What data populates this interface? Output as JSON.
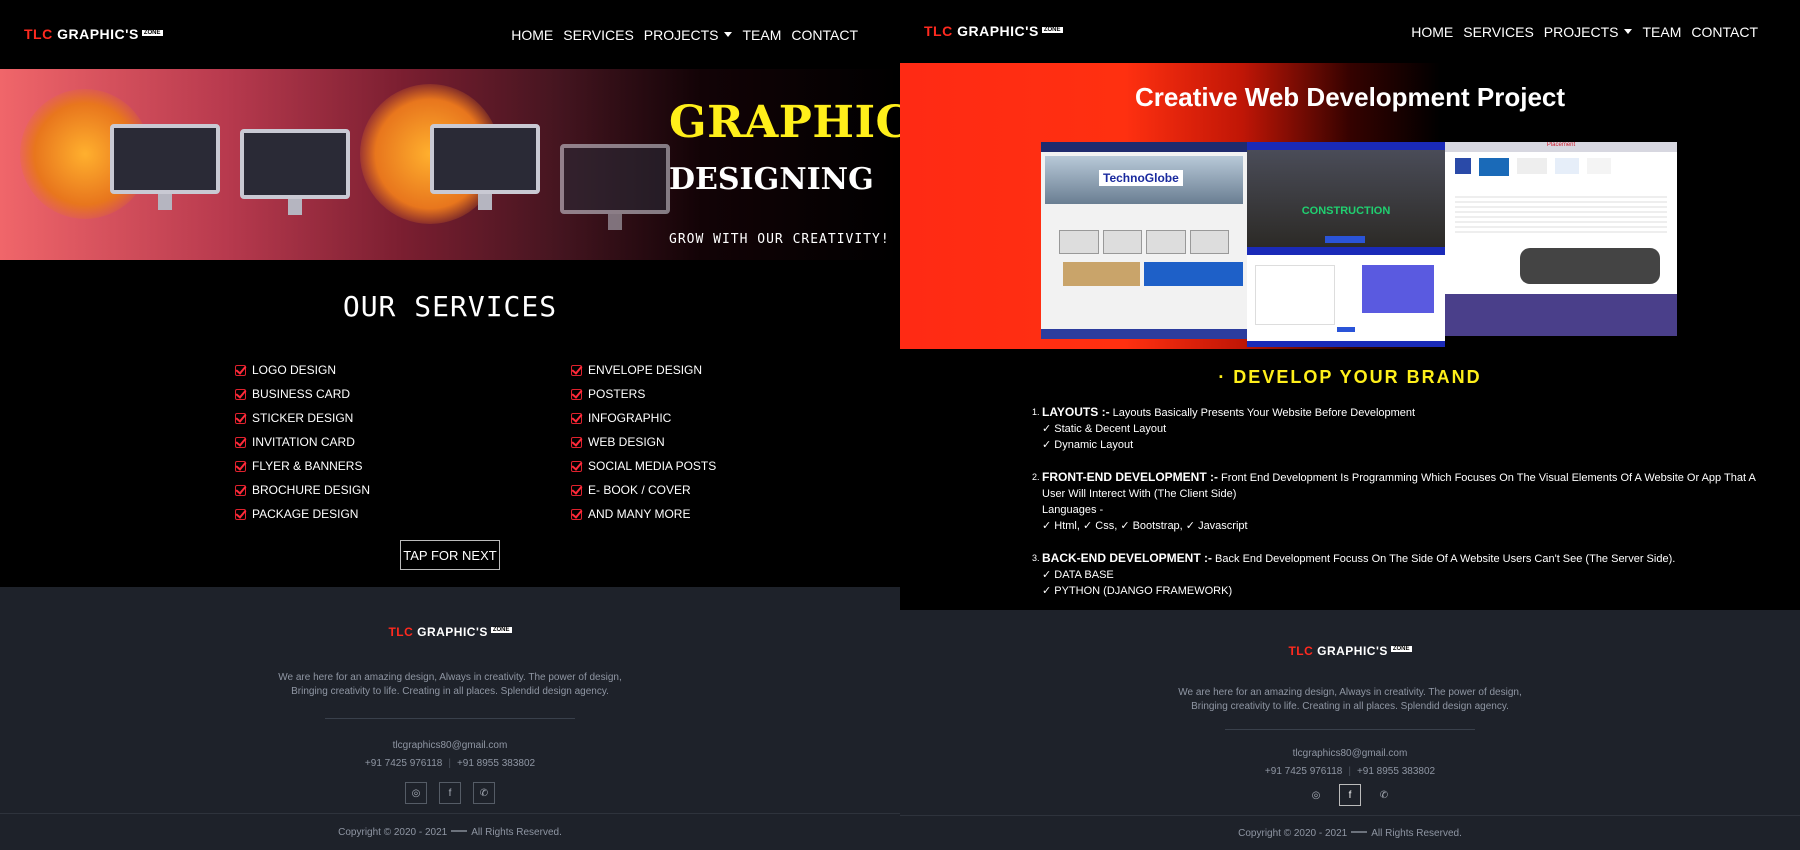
{
  "left": {
    "logo": {
      "tlc": "TLC",
      "graphics": "GRAPHIC'S",
      "zone": "ZONE"
    },
    "nav": {
      "home": "HOME",
      "services": "SERVICES",
      "projects": "PROJECTS",
      "team": "TEAM",
      "contact": "CONTACT"
    },
    "hero": {
      "title1": "GRAPHIC",
      "title2": "DESIGNING",
      "tagline": "GROW WITH OUR CREATIVITY!"
    },
    "services_title": "OUR SERVICES",
    "services_left": [
      "LOGO DESIGN",
      "BUSINESS CARD",
      "STICKER DESIGN",
      "INVITATION CARD",
      "FLYER & BANNERS",
      "BROCHURE DESIGN",
      "PACKAGE DESIGN"
    ],
    "services_right": [
      "ENVELOPE DESIGN",
      "POSTERS",
      "INFOGRAPHIC",
      "WEB DESIGN",
      "SOCIAL MEDIA POSTS",
      "E- BOOK / COVER",
      "AND MANY MORE"
    ],
    "next_button": "TAP FOR NEXT"
  },
  "right": {
    "logo": {
      "tlc": "TLC",
      "graphics": "GRAPHIC'S",
      "zone": "ZONE"
    },
    "nav": {
      "home": "HOME",
      "services": "SERVICES",
      "projects": "PROJECTS",
      "team": "TEAM",
      "contact": "CONTACT"
    },
    "title": "Creative Web Development Project",
    "brand": "· DEVELOP YOUR BRAND",
    "items": [
      {
        "num": "1.",
        "head": "LAYOUTS :-",
        "desc": " Layouts Basically Presents Your Website Before Development",
        "lines": [
          "✓ Static & Decent Layout",
          "✓ Dynamic Layout"
        ]
      },
      {
        "num": "2.",
        "head": "FRONT-END DEVELOPMENT :-",
        "desc": " Front End Development Is Programming Which Focuses On The Visual Elements Of A Website Or App That A User Will Interect With (The Client Side)",
        "lines": [
          "Languages -",
          "✓ Html, ✓ Css, ✓ Bootstrap, ✓ Javascript"
        ]
      },
      {
        "num": "3.",
        "head": "BACK-END DEVELOPMENT :-",
        "desc": " Back End Development Focuss On The Side Of A Website Users Can't See (The Server Side).",
        "lines": [
          "✓ DATA BASE",
          "✓ PYTHON (DJANGO FRAMEWORK)"
        ]
      }
    ],
    "screens": {
      "a": "TechnoGlobe",
      "b": "CONSTRUCTION",
      "c": "Placement"
    }
  },
  "footer": {
    "text1": "We are here for an amazing design, Always in creativity. The power of design,",
    "text2": "Bringing creativity to life. Creating in all places. Splendid design agency.",
    "email": "tlcgraphics80@gmail.com",
    "phone1": "+91 7425 976118",
    "phone2": "+91 8955 383802",
    "copyright": "Copyright © 2020 - 2021",
    "rights": "All Rights Reserved."
  },
  "colors": {
    "accent_red": "#ff2a1f",
    "accent_yellow": "#ffef1a",
    "footer_bg": "#1e222a"
  }
}
